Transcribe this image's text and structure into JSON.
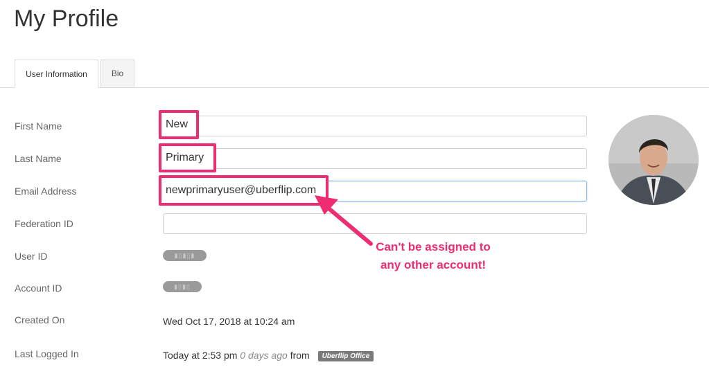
{
  "page": {
    "title": "My Profile"
  },
  "tabs": [
    {
      "label": "User Information",
      "active": true
    },
    {
      "label": "Bio",
      "active": false
    }
  ],
  "fields": {
    "first_name": {
      "label": "First Name",
      "value": "New"
    },
    "last_name": {
      "label": "Last Name",
      "value": "Primary"
    },
    "email": {
      "label": "Email Address",
      "value": "newprimaryuser@uberflip.com"
    },
    "federation_id": {
      "label": "Federation ID",
      "value": ""
    },
    "user_id": {
      "label": "User ID"
    },
    "account_id": {
      "label": "Account ID"
    },
    "created_on": {
      "label": "Created On",
      "value": "Wed Oct 17, 2018 at 10:24 am"
    },
    "last_logged_in": {
      "label": "Last Logged In",
      "time": "Today at 2:53 pm",
      "ago": "0 days ago",
      "from": "from",
      "location_badge": "Uberflip Office"
    }
  },
  "annotation": {
    "line1": "Can't be assigned to",
    "line2": "any other account!",
    "color": "#ee2c72"
  },
  "avatar": {
    "icon": "user-avatar"
  }
}
